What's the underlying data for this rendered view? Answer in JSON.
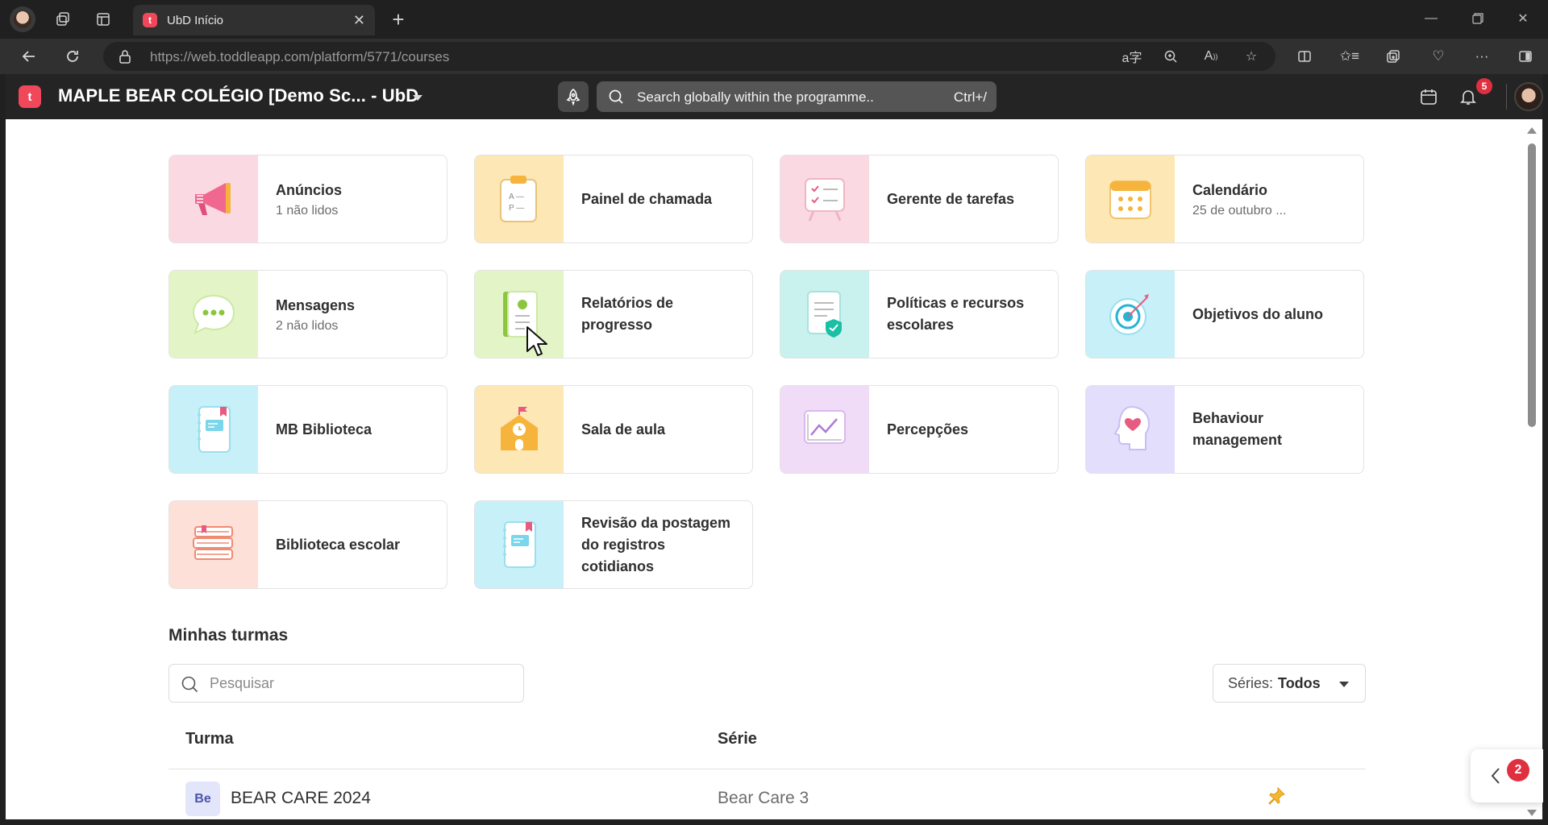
{
  "browser": {
    "tab_title": "UbD Início",
    "tab_favicon": "t",
    "url_host": "https://web.toddleapp.com",
    "url_path": "/platform/5771/courses"
  },
  "app": {
    "logo_letter": "t",
    "school_name": "MAPLE BEAR COLÉGIO [Demo Sc... - UbD",
    "search_placeholder": "Search globally within the programme..",
    "search_shortcut": "Ctrl+/",
    "notifications_count": "5",
    "colors": {
      "brand": "#f0485a",
      "badge": "#e0303f"
    }
  },
  "tools": [
    {
      "title": "Anúncios",
      "subtitle": "1 não lidos",
      "icon": "megaphone-icon",
      "bg": "#fbd9e3"
    },
    {
      "title": "Painel de chamada",
      "subtitle": "",
      "icon": "clipboard-icon",
      "bg": "#fde7b4"
    },
    {
      "title": "Gerente de tarefas",
      "subtitle": "",
      "icon": "task-board-icon",
      "bg": "#fbd9e3"
    },
    {
      "title": "Calendário",
      "subtitle": "25 de outubro ...",
      "icon": "calendar-icon",
      "bg": "#fde7b4"
    },
    {
      "title": "Mensagens",
      "subtitle": "2 não lidos",
      "icon": "chat-bubble-icon",
      "bg": "#e3f5c6"
    },
    {
      "title": "Relatórios de progresso",
      "subtitle": "",
      "icon": "report-book-icon",
      "bg": "#e3f5c6"
    },
    {
      "title": "Políticas e recursos escolares",
      "subtitle": "",
      "icon": "policy-doc-icon",
      "bg": "#c9f1ee"
    },
    {
      "title": "Objetivos do aluno",
      "subtitle": "",
      "icon": "target-icon",
      "bg": "#c7f0f8"
    },
    {
      "title": "MB Biblioteca",
      "subtitle": "",
      "icon": "notebook-icon",
      "bg": "#c7f0f8"
    },
    {
      "title": "Sala de aula",
      "subtitle": "",
      "icon": "school-building-icon",
      "bg": "#fde7b4"
    },
    {
      "title": "Percepções",
      "subtitle": "",
      "icon": "line-chart-icon",
      "bg": "#f1dcf8"
    },
    {
      "title": "Behaviour management",
      "subtitle": "",
      "icon": "head-heart-icon",
      "bg": "#e2defc"
    },
    {
      "title": "Biblioteca escolar",
      "subtitle": "",
      "icon": "books-stack-icon",
      "bg": "#fde0d8"
    },
    {
      "title": "Revisão da postagem do registros cotidianos",
      "subtitle": "",
      "icon": "journal-icon",
      "bg": "#c7f0f8"
    }
  ],
  "classes": {
    "section_title": "Minhas turmas",
    "search_placeholder": "Pesquisar",
    "grade_filter_label": "Séries:",
    "grade_filter_value": "Todos",
    "col_class": "Turma",
    "col_grade": "Série",
    "rows": [
      {
        "badge": "Be",
        "name": "BEAR CARE 2024",
        "grade": "Bear Care 3",
        "pinned": true
      }
    ]
  },
  "floating_panel": {
    "count": "2"
  }
}
